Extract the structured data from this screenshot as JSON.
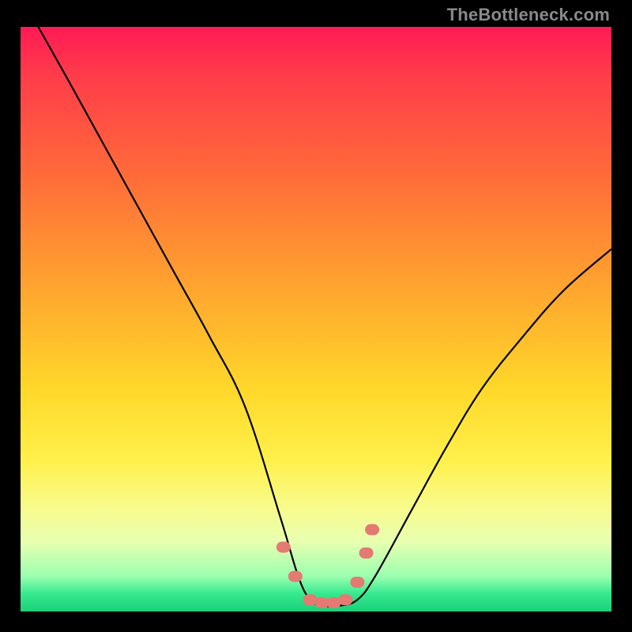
{
  "attribution": "TheBottleneck.com",
  "chart_data": {
    "type": "line",
    "title": "",
    "xlabel": "",
    "ylabel": "",
    "xlim": [
      0,
      100
    ],
    "ylim": [
      0,
      100
    ],
    "series": [
      {
        "name": "bottleneck-curve",
        "x": [
          3,
          8,
          14,
          20,
          26,
          32,
          38,
          44,
          47,
          49,
          51,
          54,
          57,
          60,
          66,
          72,
          78,
          85,
          92,
          100
        ],
        "y": [
          100,
          91,
          80,
          69,
          58,
          47,
          35,
          16,
          6,
          2,
          1,
          1,
          2,
          6,
          17,
          28,
          38,
          47,
          55,
          62
        ]
      }
    ],
    "highlight_points": {
      "name": "curve-markers",
      "x": [
        44.5,
        46.5,
        49,
        51,
        53,
        55,
        57,
        58.5,
        59.5
      ],
      "y": [
        11,
        6,
        2,
        1.5,
        1.5,
        2,
        5,
        10,
        14
      ]
    },
    "gradient_stops": [
      {
        "pos": 0.0,
        "color": "#ff1a55"
      },
      {
        "pos": 0.25,
        "color": "#ff6a3a"
      },
      {
        "pos": 0.5,
        "color": "#ffc82e"
      },
      {
        "pos": 0.74,
        "color": "#fff04a"
      },
      {
        "pos": 0.9,
        "color": "#d8ffb0"
      },
      {
        "pos": 1.0,
        "color": "#1ad07a"
      }
    ]
  }
}
